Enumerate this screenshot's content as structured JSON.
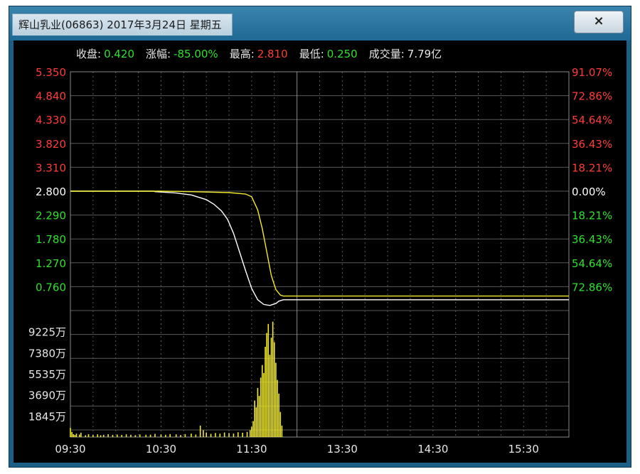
{
  "window": {
    "title": "辉山乳业(06863)  2017年3月24日  星期五",
    "close_label": "×"
  },
  "stats": [
    {
      "label": "收盘:",
      "value": "0.420",
      "color": "#2de12d"
    },
    {
      "label": "涨幅:",
      "value": "-85.00%",
      "color": "#2de12d"
    },
    {
      "label": "最高:",
      "value": "2.810",
      "color": "#ff3b3b"
    },
    {
      "label": "最低:",
      "value": "0.250",
      "color": "#2de12d"
    },
    {
      "label": "成交量:",
      "value": "7.79亿",
      "color": "#e6e6e6"
    }
  ],
  "colors": {
    "up": "#ff3b3b",
    "down": "#2de12d",
    "neutral": "#ffffff",
    "price_line": "#ffffff",
    "avg_line": "#f2ea2c",
    "volume": "#f2ea2c",
    "grid": "#5a5a5a",
    "axis_text": "#e6e6e6"
  },
  "chart_data": {
    "type": "line",
    "prev_close": 2.8,
    "x_ticks": [
      "09:30",
      "10:30",
      "11:30",
      "13:30",
      "14:30",
      "15:30"
    ],
    "price_axis": {
      "ylim": [
        0.25,
        5.35
      ],
      "ticks": [
        5.35,
        4.84,
        4.33,
        3.82,
        3.31,
        2.8,
        2.29,
        1.78,
        1.27,
        0.76
      ],
      "tick_labels": [
        "5.350",
        "4.840",
        "4.330",
        "3.820",
        "3.310",
        "2.800",
        "2.290",
        "1.780",
        "1.270",
        "0.760"
      ]
    },
    "pct_axis": {
      "ticks": [
        "91.07%",
        "72.86%",
        "54.64%",
        "36.43%",
        "18.21%",
        "0.00%",
        "18.21%",
        "36.43%",
        "54.64%",
        "72.86%"
      ],
      "signs": [
        "up",
        "up",
        "up",
        "up",
        "up",
        "neutral",
        "down",
        "down",
        "down",
        "down"
      ]
    },
    "volume_axis": {
      "unit": "万",
      "ylim": [
        0,
        11070
      ],
      "ticks": [
        9225,
        7380,
        5535,
        3690,
        1845
      ],
      "tick_labels": [
        "9225万",
        "7380万",
        "5535万",
        "3690万",
        "1845万"
      ]
    },
    "series": [
      {
        "key": "price",
        "points": [
          [
            0,
            2.8
          ],
          [
            55,
            2.8
          ],
          [
            56,
            2.79
          ],
          [
            70,
            2.76
          ],
          [
            80,
            2.72
          ],
          [
            90,
            2.62
          ],
          [
            95,
            2.52
          ],
          [
            100,
            2.38
          ],
          [
            104,
            2.2
          ],
          [
            108,
            1.9
          ],
          [
            112,
            1.5
          ],
          [
            116,
            1.1
          ],
          [
            120,
            0.72
          ],
          [
            124,
            0.48
          ],
          [
            128,
            0.38
          ],
          [
            132,
            0.36
          ],
          [
            136,
            0.4
          ],
          [
            138,
            0.45
          ],
          [
            141,
            0.48
          ],
          [
            330,
            0.48
          ]
        ]
      },
      {
        "key": "average",
        "points": [
          [
            0,
            2.8
          ],
          [
            60,
            2.8
          ],
          [
            80,
            2.79
          ],
          [
            105,
            2.77
          ],
          [
            116,
            2.74
          ],
          [
            120,
            2.68
          ],
          [
            124,
            2.4
          ],
          [
            127,
            2.0
          ],
          [
            130,
            1.5
          ],
          [
            133,
            1.0
          ],
          [
            136,
            0.7
          ],
          [
            139,
            0.58
          ],
          [
            141,
            0.56
          ],
          [
            330,
            0.56
          ]
        ]
      }
    ],
    "volume_bars": [
      [
        0,
        800
      ],
      [
        1,
        450
      ],
      [
        2,
        250
      ],
      [
        3,
        180
      ],
      [
        4,
        300
      ],
      [
        6,
        220
      ],
      [
        7,
        380
      ],
      [
        10,
        160
      ],
      [
        12,
        250
      ],
      [
        15,
        180
      ],
      [
        18,
        240
      ],
      [
        20,
        160
      ],
      [
        22,
        200
      ],
      [
        25,
        250
      ],
      [
        28,
        190
      ],
      [
        31,
        220
      ],
      [
        34,
        180
      ],
      [
        37,
        240
      ],
      [
        40,
        200
      ],
      [
        43,
        170
      ],
      [
        46,
        230
      ],
      [
        50,
        200
      ],
      [
        53,
        210
      ],
      [
        56,
        280
      ],
      [
        60,
        230
      ],
      [
        63,
        200
      ],
      [
        66,
        260
      ],
      [
        70,
        240
      ],
      [
        73,
        180
      ],
      [
        76,
        260
      ],
      [
        80,
        300
      ],
      [
        83,
        220
      ],
      [
        86,
        1000
      ],
      [
        88,
        600
      ],
      [
        90,
        400
      ],
      [
        93,
        280
      ],
      [
        96,
        350
      ],
      [
        99,
        300
      ],
      [
        102,
        400
      ],
      [
        105,
        350
      ],
      [
        108,
        300
      ],
      [
        111,
        420
      ],
      [
        114,
        380
      ],
      [
        117,
        450
      ],
      [
        119,
        600
      ],
      [
        120,
        900
      ],
      [
        121,
        1400
      ],
      [
        122,
        3200
      ],
      [
        123,
        2600
      ],
      [
        124,
        4300
      ],
      [
        125,
        3600
      ],
      [
        126,
        5200
      ],
      [
        127,
        6300
      ],
      [
        128,
        5600
      ],
      [
        129,
        7900
      ],
      [
        130,
        9100
      ],
      [
        131,
        9900
      ],
      [
        132,
        7200
      ],
      [
        133,
        8700
      ],
      [
        134,
        10100
      ],
      [
        135,
        8300
      ],
      [
        136,
        6500
      ],
      [
        137,
        5000
      ],
      [
        138,
        3800
      ],
      [
        139,
        2200
      ],
      [
        140,
        1000
      ]
    ]
  }
}
